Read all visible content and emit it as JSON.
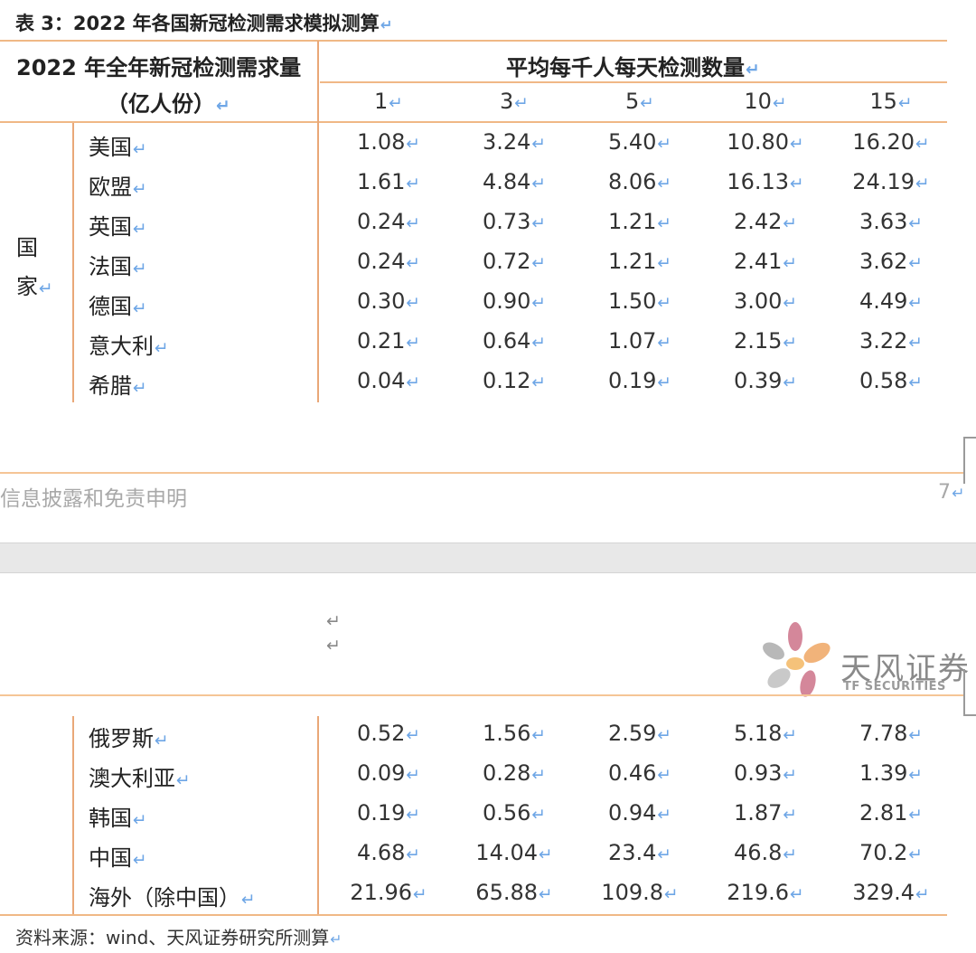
{
  "title": "表 3：2022 年各国新冠检测需求模拟测算",
  "header": {
    "left_line1": "2022 年全年新冠检测需求量",
    "left_line2": "（亿人份）",
    "right": "平均每千人每天检测数量",
    "columns": [
      "1",
      "3",
      "5",
      "10",
      "15"
    ]
  },
  "group_label": [
    "国",
    "家"
  ],
  "rows_page1": [
    {
      "name": "美国",
      "values": [
        "1.08",
        "3.24",
        "5.40",
        "10.80",
        "16.20"
      ]
    },
    {
      "name": "欧盟",
      "values": [
        "1.61",
        "4.84",
        "8.06",
        "16.13",
        "24.19"
      ]
    },
    {
      "name": "英国",
      "values": [
        "0.24",
        "0.73",
        "1.21",
        "2.42",
        "3.63"
      ]
    },
    {
      "name": "法国",
      "values": [
        "0.24",
        "0.72",
        "1.21",
        "2.41",
        "3.62"
      ]
    },
    {
      "name": "德国",
      "values": [
        "0.30",
        "0.90",
        "1.50",
        "3.00",
        "4.49"
      ]
    },
    {
      "name": "意大利",
      "values": [
        "0.21",
        "0.64",
        "1.07",
        "2.15",
        "3.22"
      ]
    },
    {
      "name": "希腊",
      "values": [
        "0.04",
        "0.12",
        "0.19",
        "0.39",
        "0.58"
      ]
    }
  ],
  "rows_page2": [
    {
      "name": "俄罗斯",
      "values": [
        "0.52",
        "1.56",
        "2.59",
        "5.18",
        "7.78"
      ]
    },
    {
      "name": "澳大利亚",
      "values": [
        "0.09",
        "0.28",
        "0.46",
        "0.93",
        "1.39"
      ]
    },
    {
      "name": "韩国",
      "values": [
        "0.19",
        "0.56",
        "0.94",
        "1.87",
        "2.81"
      ]
    },
    {
      "name": "中国",
      "values": [
        "4.68",
        "14.04",
        "23.4",
        "46.8",
        "70.2"
      ]
    },
    {
      "name": "海外（除中国）",
      "values": [
        "21.96",
        "65.88",
        "109.8",
        "219.6",
        "329.4"
      ]
    }
  ],
  "footer": {
    "disclaimer": "信息披露和免责申明",
    "page_number": "7"
  },
  "logo": {
    "name": "天风证券",
    "sub": "TF SECURITIES",
    "colors": [
      "#f1b37a",
      "#d4879a",
      "#b8b8b8",
      "#f5c27a"
    ]
  },
  "source": "资料来源：wind、天风证券研究所测算"
}
